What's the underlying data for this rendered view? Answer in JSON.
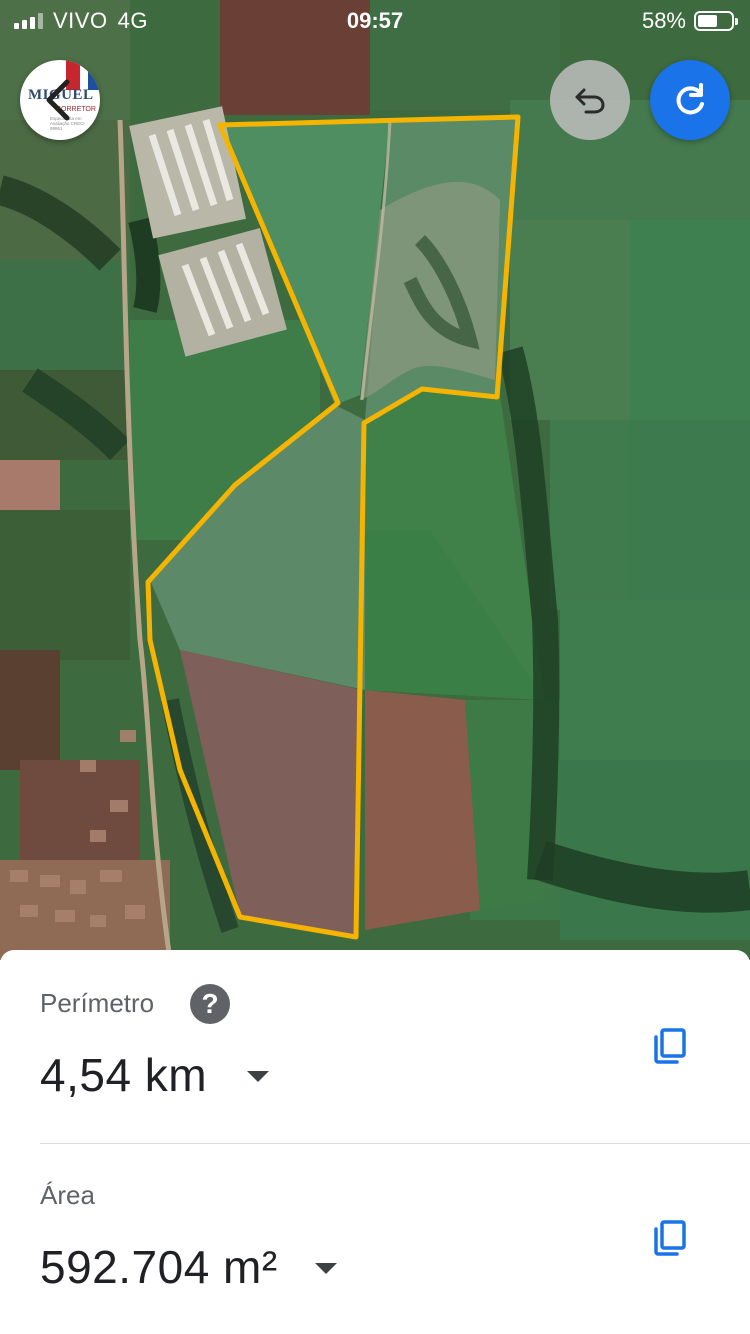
{
  "status_bar": {
    "carrier": "VIVO",
    "network": "4G",
    "time": "09:57",
    "battery": "58%",
    "battery_level": 0.58
  },
  "logo": {
    "name": "MIGUEL",
    "subtitle": "CORRETOR",
    "tagline": "Especialista em Avaliação CRECI 99861"
  },
  "toolbar": {
    "undo_icon": "undo-arrow-icon",
    "redo_icon": "redo-arrow-icon"
  },
  "measurements": {
    "perimeter": {
      "label": "Perímetro",
      "value": "4,54 km"
    },
    "area": {
      "label": "Área",
      "value": "592.704 m²"
    }
  },
  "colors": {
    "polygon_outline": "#f4b400",
    "redo_button": "#1a73e8",
    "undo_button": "#bdbdbd",
    "text_primary": "#202124",
    "text_secondary": "#5f6368"
  }
}
